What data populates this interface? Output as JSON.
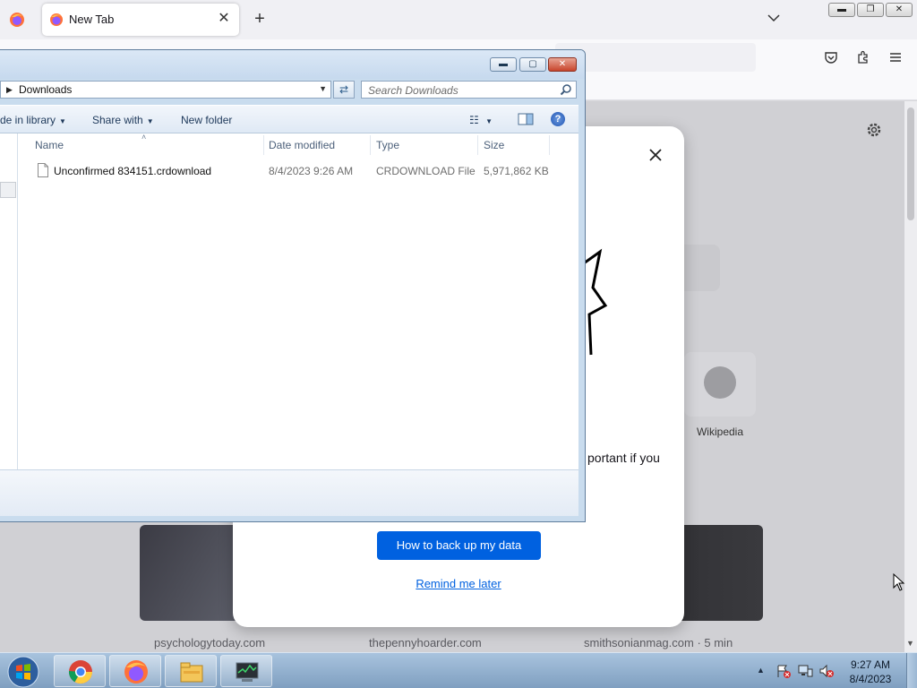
{
  "browser": {
    "tab_title": "New Tab",
    "tab_close": "✕",
    "new_tab": "+",
    "content": {
      "top_site_label": "Wikipedia",
      "story_sources": [
        "psychologytoday.com",
        "thepennyhoarder.com",
        "smithsonianmag.com · 5 min"
      ]
    },
    "modal": {
      "text": "portant if you",
      "primary_button": "How to back up my data",
      "secondary_link": "Remind me later"
    }
  },
  "explorer": {
    "address": "Downloads",
    "search_placeholder": "Search Downloads",
    "toolbar": {
      "include_in_library": "de in library",
      "share_with": "Share with",
      "new_folder": "New folder"
    },
    "columns": {
      "name": "Name",
      "date_modified": "Date modified",
      "type": "Type",
      "size": "Size"
    },
    "files": [
      {
        "name": "Unconfirmed 834151.crdownload",
        "date_modified": "8/4/2023 9:26 AM",
        "type": "CRDOWNLOAD File",
        "size": "5,971,862 KB"
      }
    ]
  },
  "taskbar": {
    "apps": [
      "chrome-icon",
      "firefox-icon",
      "file-explorer-icon",
      "task-manager-icon"
    ],
    "clock_time": "9:27 AM",
    "clock_date": "8/4/2023"
  },
  "colors": {
    "modal_button": "#0061e0",
    "taskbar": "#8fb0d2"
  }
}
